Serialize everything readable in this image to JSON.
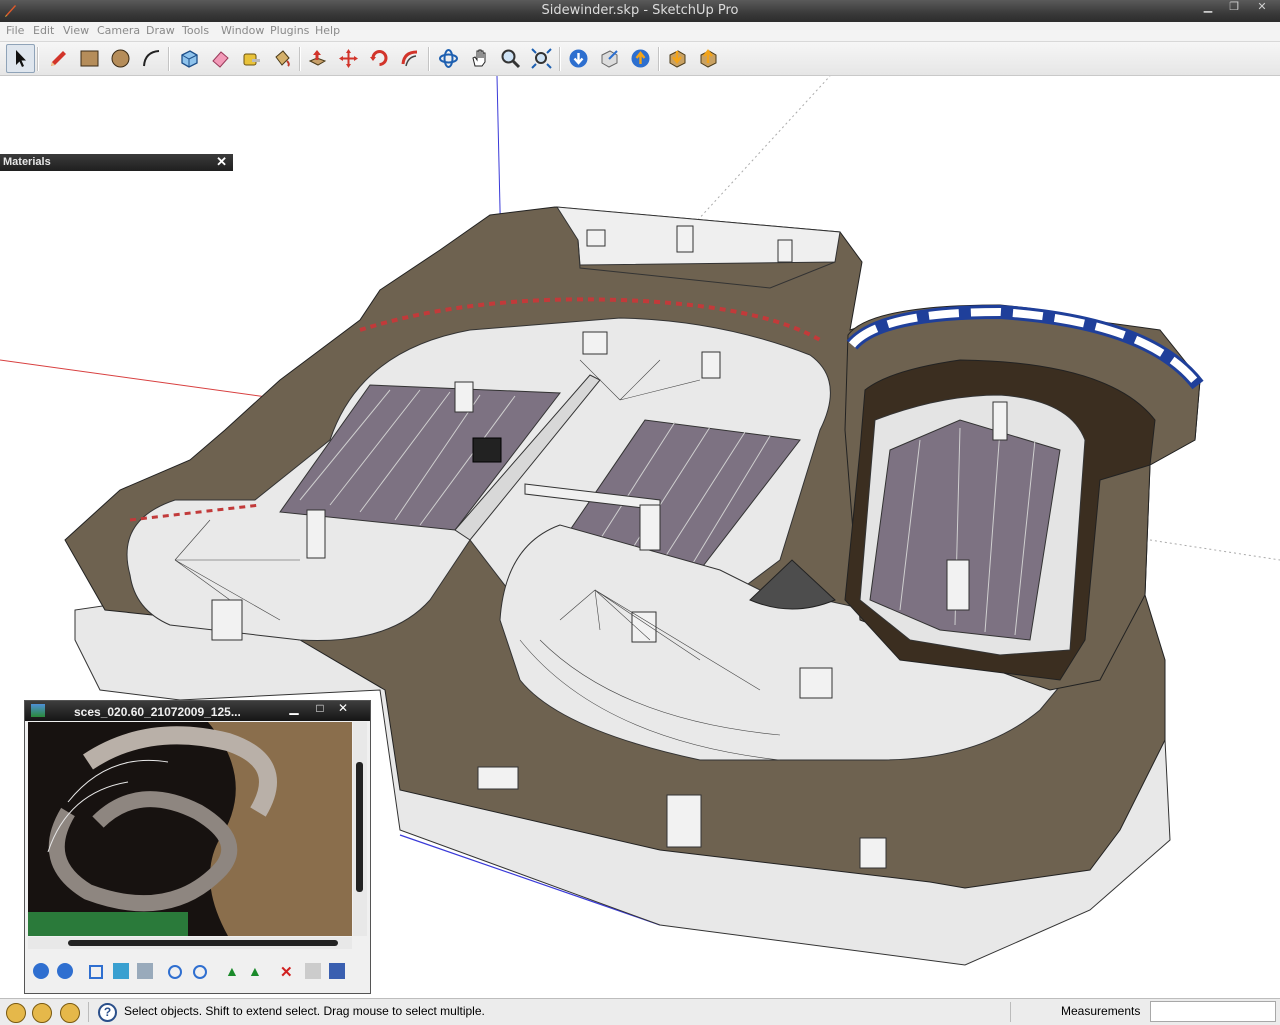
{
  "window": {
    "title": "Sidewinder.skp - SketchUp Pro"
  },
  "menu": [
    "File",
    "Edit",
    "View",
    "Camera",
    "Draw",
    "Tools",
    "Window",
    "Plugins",
    "Help"
  ],
  "toolbar": {
    "tools": [
      {
        "icon": "select-arrow-icon"
      },
      {
        "icon": "pencil-line-icon"
      },
      {
        "icon": "rectangle-icon"
      },
      {
        "icon": "circle-icon"
      },
      {
        "icon": "arc-icon"
      },
      {
        "icon": "make-component-icon"
      },
      {
        "icon": "eraser-icon"
      },
      {
        "icon": "tape-measure-icon"
      },
      {
        "icon": "paint-bucket-icon"
      },
      {
        "icon": "push-pull-icon"
      },
      {
        "icon": "move-icon"
      },
      {
        "icon": "rotate-icon"
      },
      {
        "icon": "follow-me-icon"
      },
      {
        "icon": "orbit-icon"
      },
      {
        "icon": "pan-hand-icon"
      },
      {
        "icon": "zoom-icon"
      },
      {
        "icon": "zoom-extents-icon"
      },
      {
        "icon": "get-models-icon"
      },
      {
        "icon": "share-model-icon"
      },
      {
        "icon": "share-component-icon"
      },
      {
        "icon": "get-photo-texture-icon"
      },
      {
        "icon": "export-icon"
      }
    ]
  },
  "materials_panel": {
    "title": "Materials",
    "close_glyph": "✕"
  },
  "viewer": {
    "title": "sces_020.60_21072009_125...",
    "minimize_glyph": "▁",
    "maximize_glyph": "□",
    "close_glyph": "✕"
  },
  "status": {
    "message": "Select objects. Shift to extend select. Drag mouse to select multiple.",
    "measurements_label": "Measurements",
    "measurements_value": ""
  },
  "colors": {
    "title_bar": "#3a3a3a",
    "wall": "#e6e6e6",
    "track_floor": "#e9e9e9",
    "dirt": "#6e6250",
    "lane_stripes": "#7d7282",
    "axis_red": "#d84040",
    "axis_blue": "#3a3ad8",
    "axis_green": "#34b034"
  }
}
